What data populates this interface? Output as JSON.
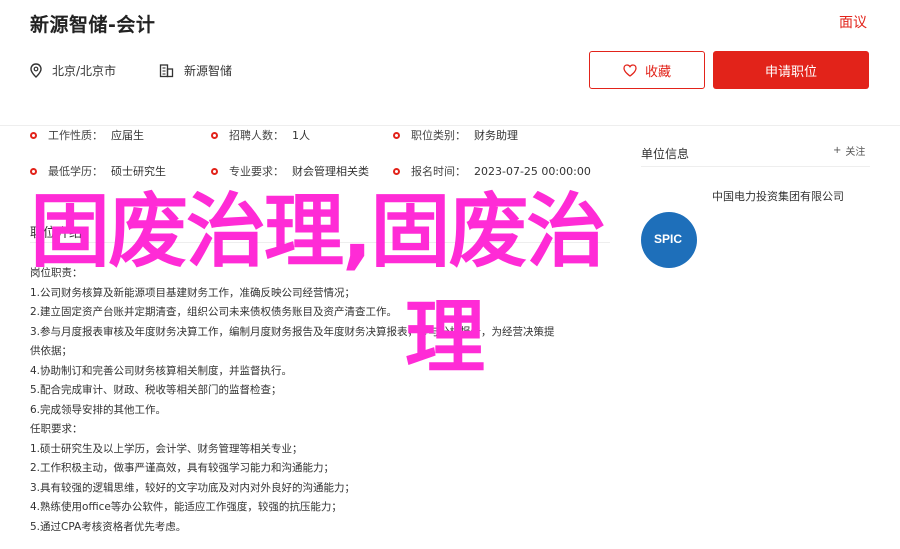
{
  "header": {
    "title": "新源智储-会计",
    "report": "面议",
    "location": "北京/北京市",
    "company": "新源智储",
    "favorite_label": "收藏",
    "apply_label": "申请职位"
  },
  "info": {
    "work_nature_k": "工作性质：",
    "work_nature_v": "应届生",
    "headcount_k": "招聘人数：",
    "headcount_v": "1人",
    "category_k": "职位类别：",
    "category_v": "财务助理",
    "education_k": "最低学历：",
    "education_v": "硕士研究生",
    "major_k": "专业要求：",
    "major_v": "财会管理相关类",
    "deadline_k": "报名时间：",
    "deadline_v": "2023-07-25 00:00:00"
  },
  "section": {
    "title": "职位介绍"
  },
  "description": [
    "岗位职责：",
    "1.公司财务核算及新能源项目基建财务工作，准确反映公司经营情况；",
    "2.建立固定资产台账并定期清查，组织公司未来债权债务账目及资产清查工作。",
    "3.参与月度报表审核及年度财务决算工作，编制月度财务报告及年度财务决算报表，参与分析报告，为经营决策提",
    "供依据；",
    "4.协助制订和完善公司财务核算相关制度，并监督执行。",
    "5.配合完成审计、财政、税收等相关部门的监督检查；",
    "6.完成领导安排的其他工作。",
    "任职要求：",
    "1.硕士研究生及以上学历，会计学、财务管理等相关专业；",
    "2.工作积极主动，做事严谨高效，具有较强学习能力和沟通能力；",
    "3.具有较强的逻辑思维，较好的文字功底及对内对外良好的沟通能力；",
    "4.熟练使用office等办公软件，能适应工作强度，较强的抗压能力；",
    "5.通过CPA考核资格者优先考虑。"
  ],
  "company_panel": {
    "title": "单位信息",
    "report": "关注",
    "name": "中国电力投资集团有限公司",
    "logo_text": "SPIC"
  },
  "overlay": {
    "line1": "固废治理,固废治",
    "line2": "理"
  },
  "colors": {
    "accent": "#e2231a",
    "overlay": "#ff2bd6",
    "logo": "#1e6fba"
  }
}
